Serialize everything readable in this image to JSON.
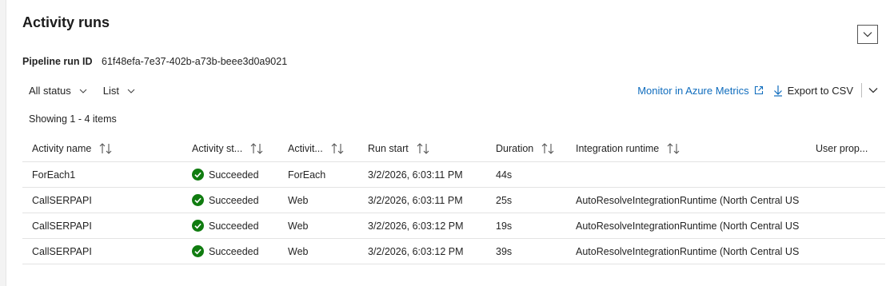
{
  "title": "Activity runs",
  "pipeline": {
    "label": "Pipeline run ID",
    "value": "61f48efa-7e37-402b-a73b-beee3d0a9021"
  },
  "toolbar": {
    "status_filter": "All status",
    "view_mode": "List",
    "monitor_link": "Monitor in Azure Metrics",
    "export_label": "Export to CSV"
  },
  "showing": "Showing 1 - 4 items",
  "columns": [
    "Activity name",
    "Activity st...",
    "Activit...",
    "Run start",
    "Duration",
    "Integration runtime",
    "User prop..."
  ],
  "rows": [
    {
      "name": "ForEach1",
      "status": "Succeeded",
      "type": "ForEach",
      "run_start": "3/2/2026, 6:03:11 PM",
      "duration": "44s",
      "runtime": ""
    },
    {
      "name": "CallSERPAPI",
      "status": "Succeeded",
      "type": "Web",
      "run_start": "3/2/2026, 6:03:11 PM",
      "duration": "25s",
      "runtime": "AutoResolveIntegrationRuntime (North Central US"
    },
    {
      "name": "CallSERPAPI",
      "status": "Succeeded",
      "type": "Web",
      "run_start": "3/2/2026, 6:03:12 PM",
      "duration": "19s",
      "runtime": "AutoResolveIntegrationRuntime (North Central US"
    },
    {
      "name": "CallSERPAPI",
      "status": "Succeeded",
      "type": "Web",
      "run_start": "3/2/2026, 6:03:12 PM",
      "duration": "39s",
      "runtime": "AutoResolveIntegrationRuntime (North Central US"
    }
  ],
  "colors": {
    "accent": "#0f6cbd",
    "success": "#107c10"
  }
}
